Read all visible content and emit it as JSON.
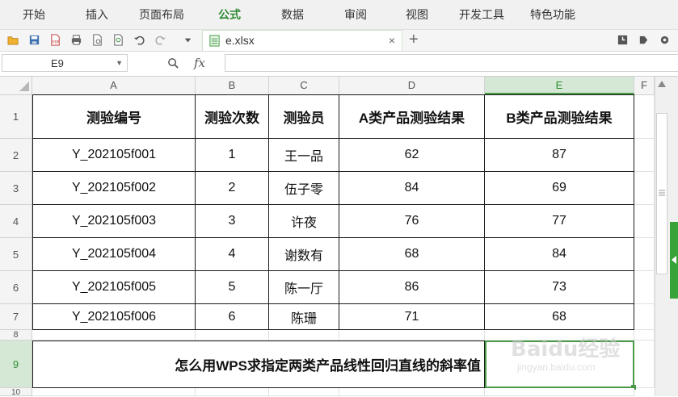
{
  "menu": [
    "开始",
    "插入",
    "页面布局",
    "公式",
    "数据",
    "审阅",
    "视图",
    "开发工具",
    "特色功能"
  ],
  "active_menu": "公式",
  "file_tab": {
    "label": "e.xlsx",
    "close": "×",
    "new_tab": "+"
  },
  "name_box": {
    "value": "E9"
  },
  "formula": {
    "fx_label": "fx",
    "value": ""
  },
  "columns": [
    "A",
    "B",
    "C",
    "D",
    "E",
    "F"
  ],
  "selected_column": "E",
  "selected_row": "9",
  "rows": [
    "1",
    "2",
    "3",
    "4",
    "5",
    "6",
    "7",
    "8",
    "9",
    "10"
  ],
  "table": {
    "headers": [
      "测验编号",
      "测验次数",
      "测验员",
      "A类产品测验结果",
      "B类产品测验结果"
    ],
    "rows": [
      [
        "Y_202105f001",
        "1",
        "王一品",
        "62",
        "87"
      ],
      [
        "Y_202105f002",
        "2",
        "伍子零",
        "84",
        "69"
      ],
      [
        "Y_202105f003",
        "3",
        "许夜",
        "76",
        "77"
      ],
      [
        "Y_202105f004",
        "4",
        "谢数有",
        "68",
        "84"
      ],
      [
        "Y_202105f005",
        "5",
        "陈一厅",
        "86",
        "73"
      ],
      [
        "Y_202105f006",
        "6",
        "陈珊",
        "71",
        "68"
      ]
    ]
  },
  "question": "怎么用WPS求指定两类产品线性回归直线的斜率值",
  "watermark": {
    "brand": "Baidu经验",
    "url": "jingyan.baidu.com"
  },
  "colors": {
    "accent": "#2e8b32",
    "selection": "#d5e8d5",
    "border": "#1a1a1a"
  }
}
